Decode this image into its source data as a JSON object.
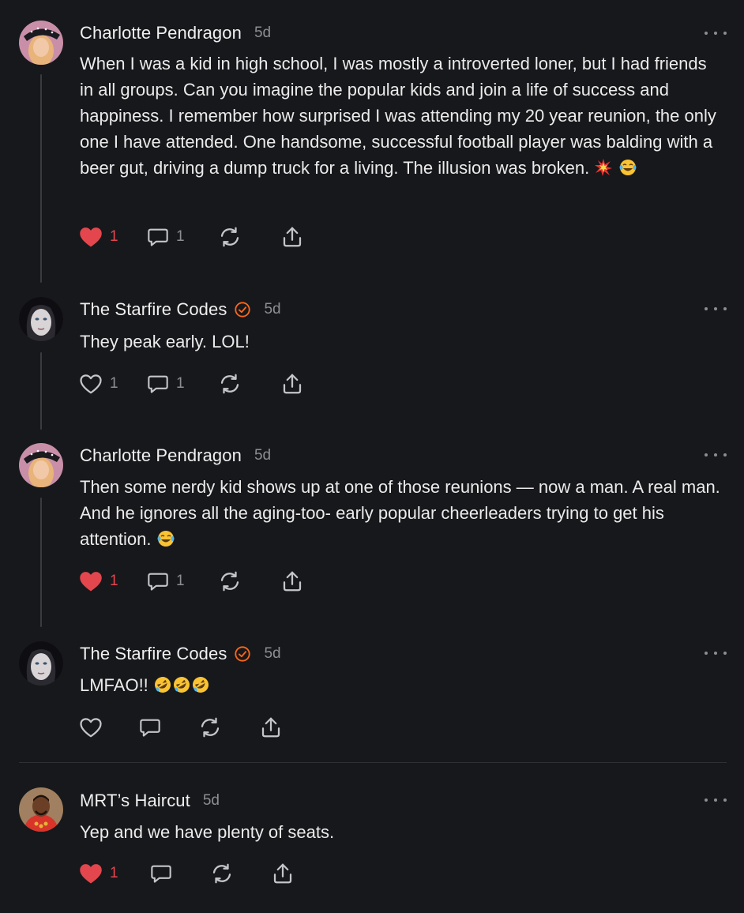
{
  "comments": [
    {
      "author": "Charlotte Pendragon",
      "time": "5d",
      "text": "When I was a kid in high school, I was mostly a introverted loner, but I had friends in all groups. Can you imagine the popular kids and join a life of success and happiness. I remember how surprised I was attending my 20 year reunion, the only one I have attended. One handsome, successful football player was balding with a beer gut, driving a dump truck for a living. The illusion was broken.",
      "emojis": [
        "collision-emoji",
        "tears-of-joy-emoji"
      ],
      "likes": "1",
      "liked": true,
      "replies": "1"
    },
    {
      "author": "The Starfire Codes",
      "verified": true,
      "time": "5d",
      "text": "They peak early. LOL!",
      "likes": "1",
      "liked": false,
      "replies": "1"
    },
    {
      "author": "Charlotte Pendragon",
      "time": "5d",
      "text": "Then some nerdy kid shows up at one of those reunions — now a man. A real man. And he ignores all the aging-too- early popular cheerleaders trying to get his attention.",
      "emojis": [
        "tears-of-joy-emoji"
      ],
      "likes": "1",
      "liked": true,
      "replies": "1"
    },
    {
      "author": "The Starfire Codes",
      "verified": true,
      "time": "5d",
      "text": "LMFAO!!",
      "emojis": [
        "rolling-laughing-emoji",
        "rolling-laughing-emoji",
        "rolling-laughing-emoji"
      ],
      "likes": "",
      "liked": false,
      "replies": ""
    },
    {
      "author": "MRT’s Haircut",
      "time": "5d",
      "text": "Yep and we have plenty of seats.",
      "likes": "1",
      "liked": true,
      "replies": ""
    }
  ],
  "colors": {
    "background": "#17181b",
    "like_active": "#e4464e",
    "verified_badge": "#ff6719",
    "muted": "#8d8e93"
  },
  "icons": {
    "like": "heart-icon",
    "reply": "speech-bubble-icon",
    "restack": "restack-arrows-icon",
    "share": "share-upload-icon",
    "menu": "more-dots-icon",
    "verified": "verified-check-icon"
  }
}
